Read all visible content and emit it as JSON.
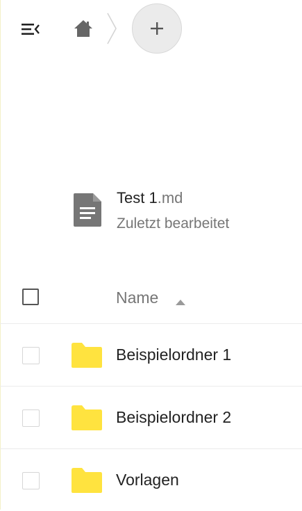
{
  "header": {
    "menu_icon": "menu-collapse-icon",
    "home_icon": "home-icon",
    "add_icon": "plus-icon"
  },
  "recent": {
    "file_base": "Test 1",
    "file_ext": ".md",
    "subtitle": "Zuletzt bearbeitet",
    "icon": "document-icon"
  },
  "list": {
    "column_name": "Name",
    "sort": "ascending",
    "rows": [
      {
        "name": "Beispielordner 1",
        "type": "folder"
      },
      {
        "name": "Beispielordner 2",
        "type": "folder"
      },
      {
        "name": "Vorlagen",
        "type": "folder"
      }
    ]
  },
  "colors": {
    "folder": "#ffe33f",
    "icon_gray": "#767676",
    "add_button_bg": "#ebebeb",
    "divider": "#ebebeb"
  }
}
